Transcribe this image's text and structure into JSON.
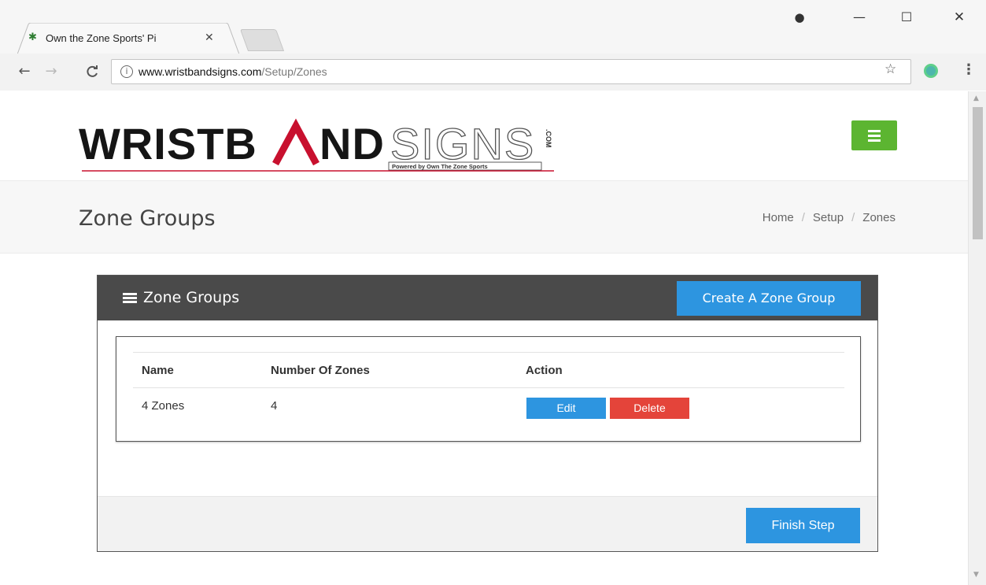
{
  "browser": {
    "tab_title": "Own the Zone Sports' Pi",
    "tab_close": "✕",
    "url_host": "www.wristbandsigns.com",
    "url_path": "/Setup/Zones",
    "info_glyph": "i",
    "icons": {
      "back": "←",
      "forward": "→",
      "reload": "C",
      "star": "☆",
      "menu": "⋮",
      "user": "●",
      "minimize": "—",
      "maximize": "☐",
      "close": "✕",
      "favicon": "✱",
      "scroll_up": "▲",
      "scroll_down": "▼"
    }
  },
  "site": {
    "logo": {
      "word_left": "WRISTB",
      "word_right": "ND",
      "word_outline": "SIGNS",
      "tagline": "Powered by Own The Zone Sports",
      "com": ".COM"
    },
    "accent_green": "#5cb531",
    "brand_red": "#c8102e"
  },
  "page": {
    "title": "Zone Groups",
    "breadcrumb": [
      "Home",
      "Setup",
      "Zones"
    ],
    "breadcrumb_sep": "/"
  },
  "panel": {
    "title": "Zone Groups",
    "create_button": "Create A Zone Group",
    "columns": [
      "Name",
      "Number Of Zones",
      "Action"
    ],
    "rows": [
      {
        "name": "4 Zones",
        "count": "4",
        "edit": "Edit",
        "delete": "Delete"
      }
    ],
    "finish_button": "Finish Step"
  },
  "colors": {
    "primary_blue": "#2d95e0",
    "danger_red": "#e4443a",
    "panel_header": "#4a4a4a"
  }
}
